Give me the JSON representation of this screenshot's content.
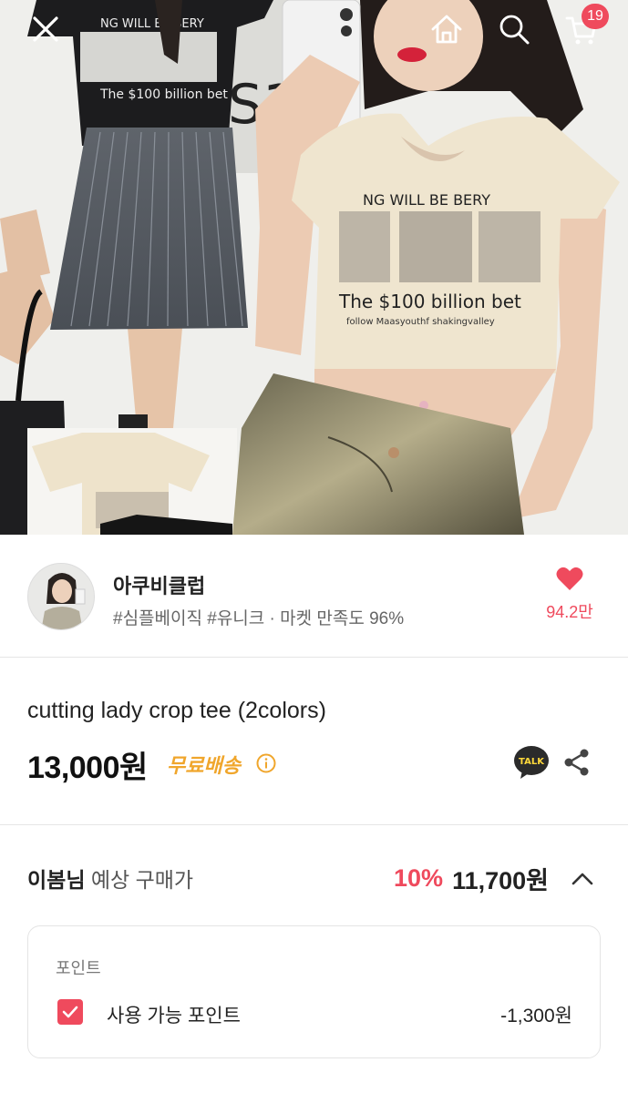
{
  "header": {
    "cart_count": "19",
    "icons": [
      "close-icon",
      "home-icon",
      "search-icon",
      "cart-icon"
    ]
  },
  "hero_photo": {
    "print_lines": [
      "NG WILL BE BERY",
      "The $100 billion bet",
      "follow Maasyouthf shakingvalley"
    ]
  },
  "shop": {
    "name": "아쿠비클럽",
    "tags": "#심플베이직 #유니크 · 마켓 만족도 96%",
    "like_count": "94.2만"
  },
  "product": {
    "title": "cutting lady crop tee (2colors)",
    "price": "13,000원",
    "shipping": "무료배송"
  },
  "expected": {
    "user_name": "이봄님",
    "label": " 예상 구매가",
    "discount": "10%",
    "price": "11,700원"
  },
  "points": {
    "heading": "포인트",
    "label": "사용 가능 포인트",
    "value": "-1,300원",
    "checked": true
  },
  "colors": {
    "accent": "#ef4a5d",
    "shipping": "#f0a62c",
    "kakao": "#2b2b2b"
  }
}
